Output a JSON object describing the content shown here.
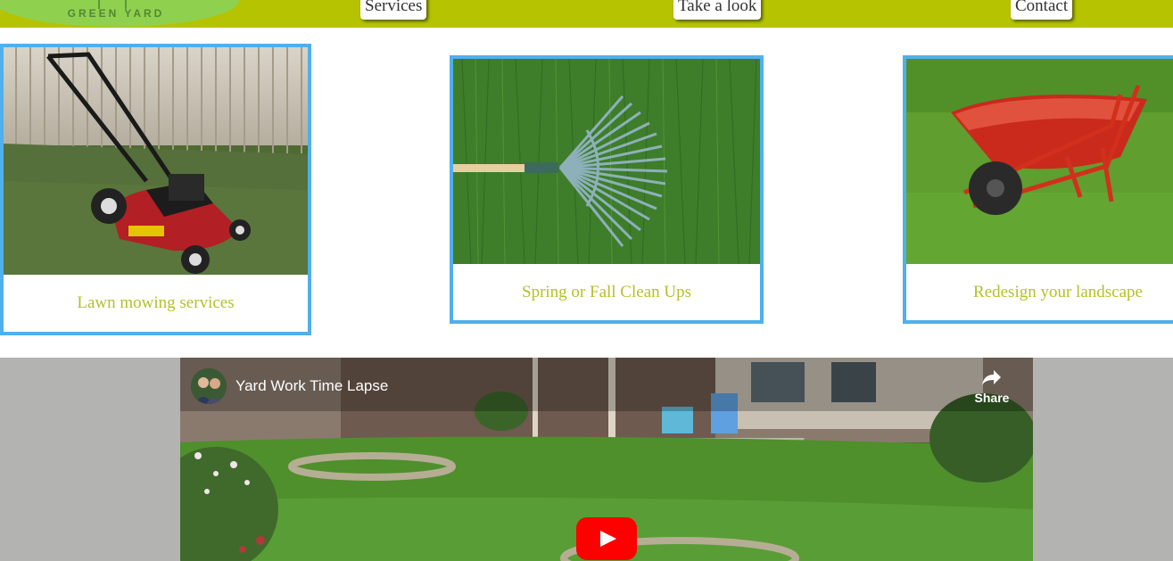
{
  "header": {
    "logo_text": "GREEN YARD",
    "nav": [
      {
        "label": "Services"
      },
      {
        "label": "Take a look"
      },
      {
        "label": "Contact"
      }
    ],
    "colors": {
      "bar": "#b5c300",
      "logo": "#8fd14f"
    }
  },
  "services": [
    {
      "caption": "Lawn mowing services",
      "image": "lawn-mower-photo"
    },
    {
      "caption": "Spring or Fall Clean Ups",
      "image": "rake-photo"
    },
    {
      "caption": "Redesign your landscape",
      "image": "wheelbarrow-photo"
    }
  ],
  "video": {
    "title": "Yard Work Time Lapse",
    "share_label": "Share",
    "icons": [
      "channel-avatar",
      "share-icon",
      "youtube-play-icon"
    ]
  },
  "colors": {
    "card_border": "#4fb0ec",
    "caption_text": "#b5c02a",
    "video_band": "#b3b3b2",
    "play_button": "#ff0000"
  }
}
